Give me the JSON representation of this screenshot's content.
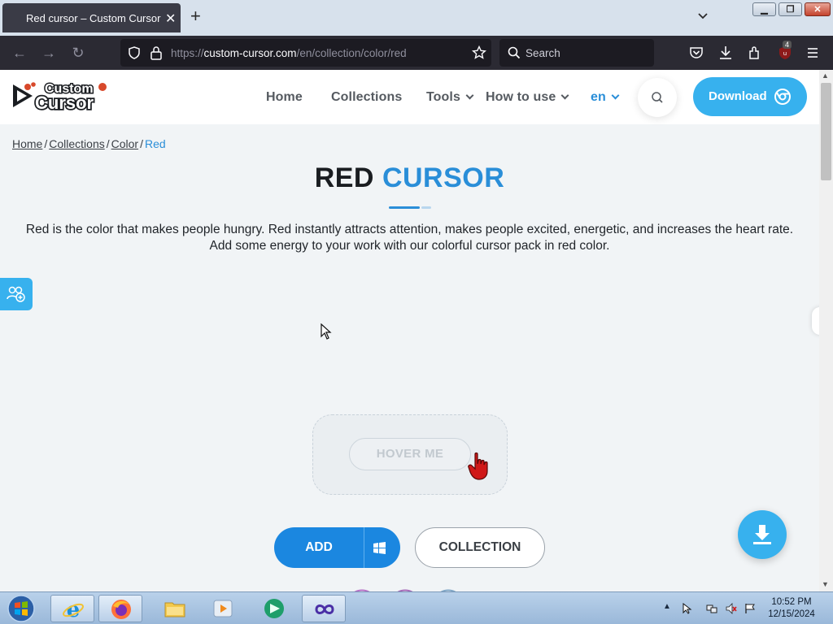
{
  "browser": {
    "tab_title": "Red cursor – Custom Cursor",
    "url_prefix": "https://",
    "url_host": "custom-cursor.com",
    "url_path": "/en/collection/color/red",
    "search_placeholder": "Search",
    "extension_badge": "4"
  },
  "header": {
    "logo_line1": "Custom",
    "logo_line2": "Cursor",
    "menu": {
      "home": "Home",
      "collections": "Collections",
      "tools": "Tools",
      "how_to_use": "How to use",
      "language": "en"
    },
    "download_label": "Download"
  },
  "breadcrumb": {
    "home": "Home",
    "collections": "Collections",
    "color": "Color",
    "current": "Red",
    "separator": "/"
  },
  "main": {
    "title_part1": "RED",
    "title_part2": "CURSOR",
    "description": "Red is the color that makes people hungry. Red instantly attracts attention, makes people excited, energetic, and increases the heart rate. Add some energy to your work with our colorful cursor pack in red color.",
    "hover_button": "HOVER ME",
    "add_button": "ADD",
    "collection_button": "COLLECTION"
  },
  "taskbar": {
    "time": "10:52 PM",
    "date": "12/15/2024"
  },
  "colors": {
    "accent_blue": "#2a8ed8",
    "light_blue": "#37b1ee",
    "add_blue": "#1b87e0"
  }
}
